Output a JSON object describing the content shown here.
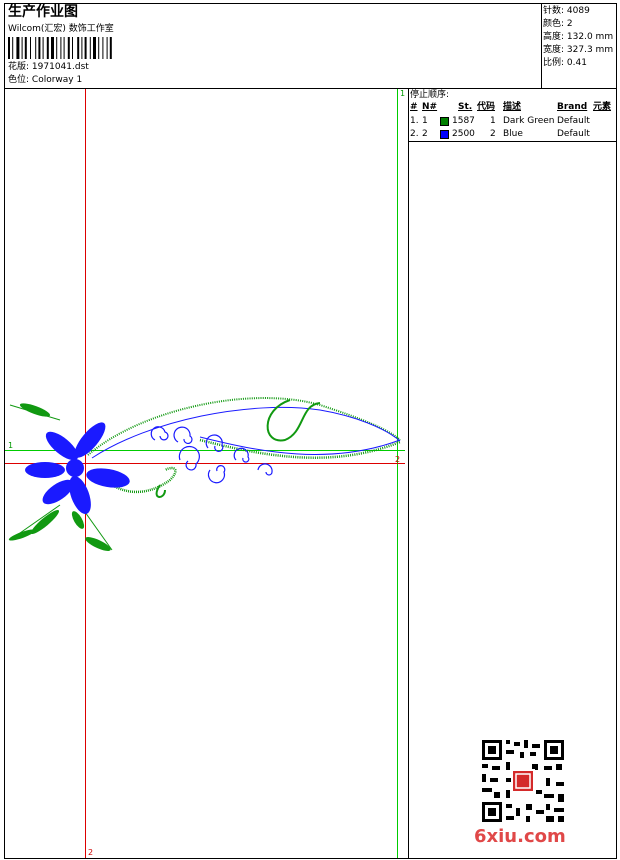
{
  "header": {
    "title": "生产作业图",
    "company": "Wilcom(汇宏) 数饰工作室",
    "design_label": "花版:",
    "design_file": "1971041.dst",
    "colorway_label": "色位:",
    "colorway": "Colorway 1"
  },
  "stats": [
    {
      "label": "针数:",
      "value": "4089"
    },
    {
      "label": "颜色:",
      "value": "2"
    },
    {
      "label": "高度:",
      "value": "132.0 mm"
    },
    {
      "label": "宽度:",
      "value": "327.3 mm"
    },
    {
      "label": "比例:",
      "value": "0.41"
    }
  ],
  "stop_sequence": {
    "title": "停止顺序:",
    "columns": [
      "#",
      "N#",
      "St.",
      "代码",
      "描述",
      "Brand",
      "元素"
    ],
    "rows": [
      {
        "index": "1.",
        "n": "1",
        "color": "#008000",
        "stitches": "1587",
        "code": "1",
        "description": "Dark Green",
        "brand": "Default"
      },
      {
        "index": "2.",
        "n": "2",
        "color": "#0000ff",
        "stitches": "2500",
        "code": "2",
        "description": "Blue",
        "brand": "Default"
      }
    ]
  },
  "guides": {
    "top_mark": "1",
    "left_mark": "1",
    "right_mark": "2",
    "bottom_mark": "2",
    "vertical_red": "#dd0000",
    "vertical_green": "#00cc00"
  },
  "watermark": "6xiu.com",
  "colors": {
    "thread_green": "#119911",
    "thread_blue": "#1a1aff"
  }
}
